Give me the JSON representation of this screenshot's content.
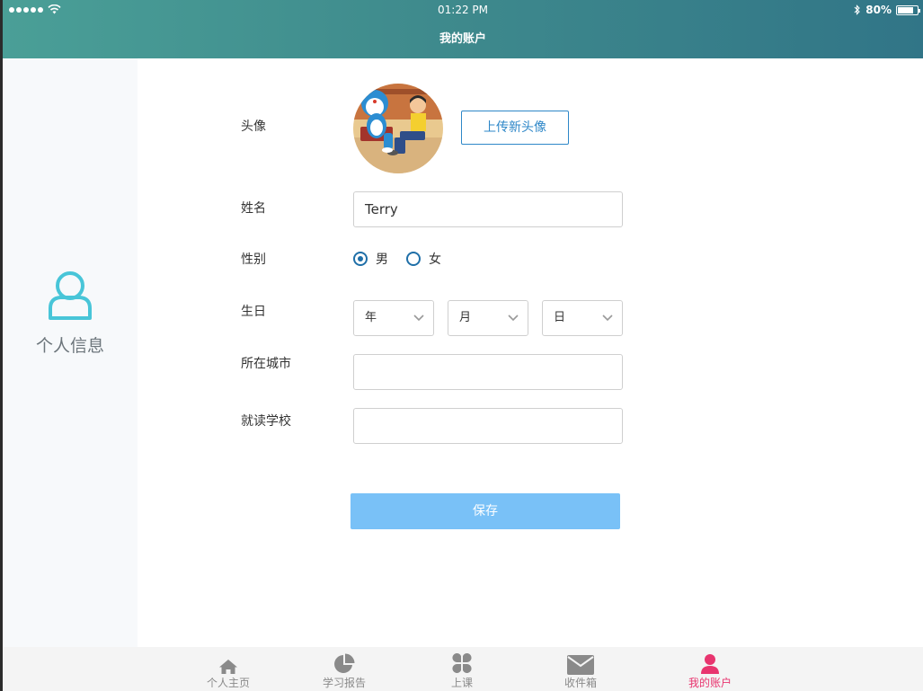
{
  "status_bar": {
    "time": "01:22 PM",
    "battery": "80%",
    "battery_level": 0.8
  },
  "header": {
    "title": "我的账户"
  },
  "sidebar": {
    "items": [
      {
        "label": "个人信息",
        "icon": "user-icon",
        "color": "#48c5d8"
      }
    ]
  },
  "form": {
    "avatar_label": "头像",
    "upload_button": "上传新头像",
    "name_label": "姓名",
    "name_value": "Terry",
    "gender_label": "性别",
    "gender_options": [
      {
        "label": "男",
        "selected": true
      },
      {
        "label": "女",
        "selected": false
      }
    ],
    "birthday_label": "生日",
    "birthday_selects": {
      "year": "年",
      "month": "月",
      "day": "日"
    },
    "city_label": "所在城市",
    "city_value": "",
    "school_label": "就读学校",
    "school_value": "",
    "save_button": "保存"
  },
  "tabbar": {
    "tabs": [
      {
        "label": "个人主页",
        "icon": "home-icon",
        "active": false
      },
      {
        "label": "学习报告",
        "icon": "pie-chart-icon",
        "active": false
      },
      {
        "label": "上课",
        "icon": "clover-icon",
        "active": false
      },
      {
        "label": "收件箱",
        "icon": "mail-icon",
        "active": false
      },
      {
        "label": "我的账户",
        "icon": "person-icon",
        "active": true
      }
    ],
    "active_color": "#e8356f",
    "inactive_color": "#8a8a8a"
  },
  "colors": {
    "header_start": "#4a9f97",
    "header_end": "#317587",
    "primary": "#2e87c8",
    "save_button": "#79c1f7"
  }
}
